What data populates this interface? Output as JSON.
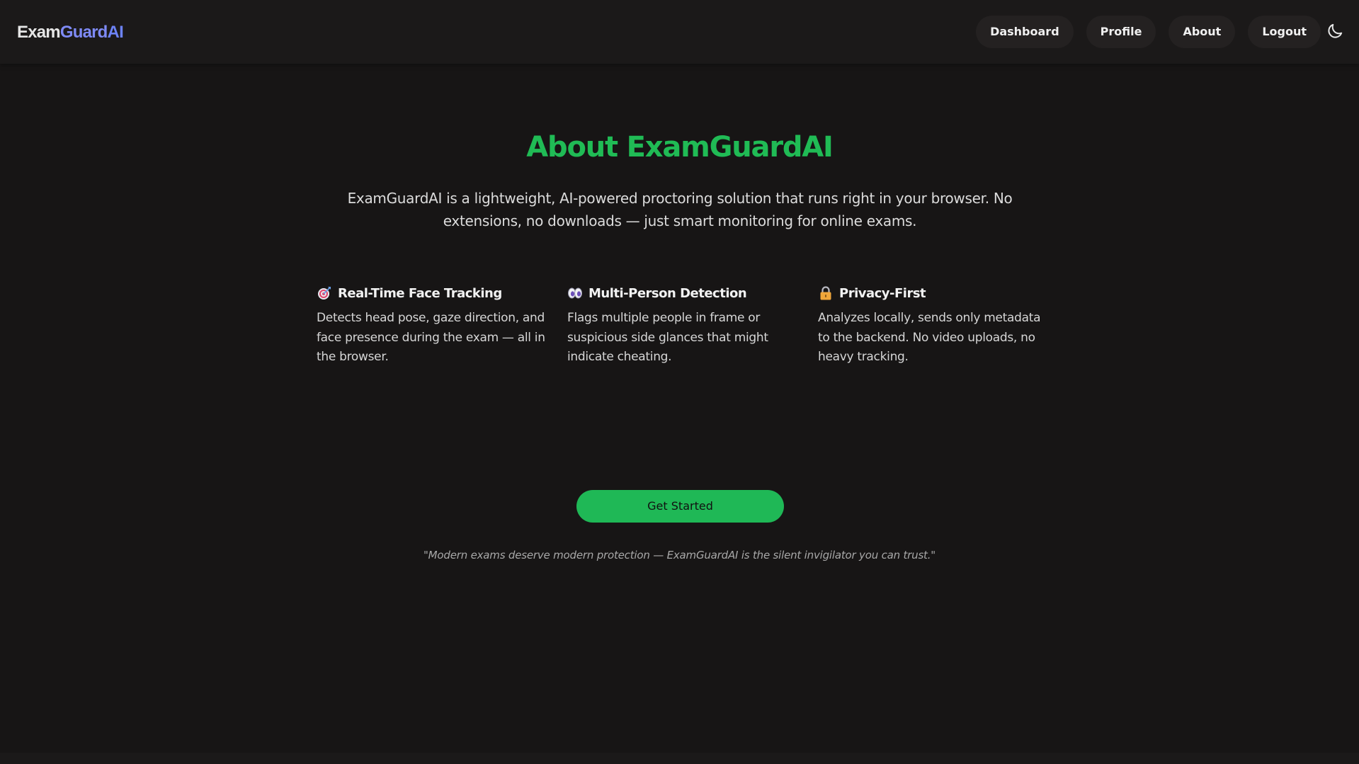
{
  "brand": {
    "part1": "Exam",
    "part2": "Guard",
    "part3": "AI"
  },
  "nav": {
    "items": [
      "Dashboard",
      "Profile",
      "About",
      "Logout"
    ],
    "theme_toggle_icon": "moon-icon"
  },
  "about": {
    "title": "About ExamGuardAI",
    "intro": "ExamGuardAI is a lightweight, AI-powered proctoring solution that runs right in your browser. No extensions, no downloads — just smart monitoring for online exams.",
    "features": [
      {
        "icon": "target-icon",
        "title": "Real-Time Face Tracking",
        "description": "Detects head pose, gaze direction, and face presence during the exam — all in the browser."
      },
      {
        "icon": "eyes-icon",
        "title": "Multi-Person Detection",
        "description": "Flags multiple people in frame or suspicious side glances that might indicate cheating."
      },
      {
        "icon": "lock-icon",
        "title": "Privacy-First",
        "description": "Analyzes locally, sends only metadata to the backend. No video uploads, no heavy tracking."
      }
    ],
    "cta_label": "Get Started",
    "quote": "\"Modern exams deserve modern protection — ExamGuardAI is the silent invigilator you can trust.\""
  },
  "colors": {
    "background": "#171515",
    "navbar": "#1b1919",
    "accent_green": "#1fb856",
    "brand_blue": "#6d83f6"
  }
}
